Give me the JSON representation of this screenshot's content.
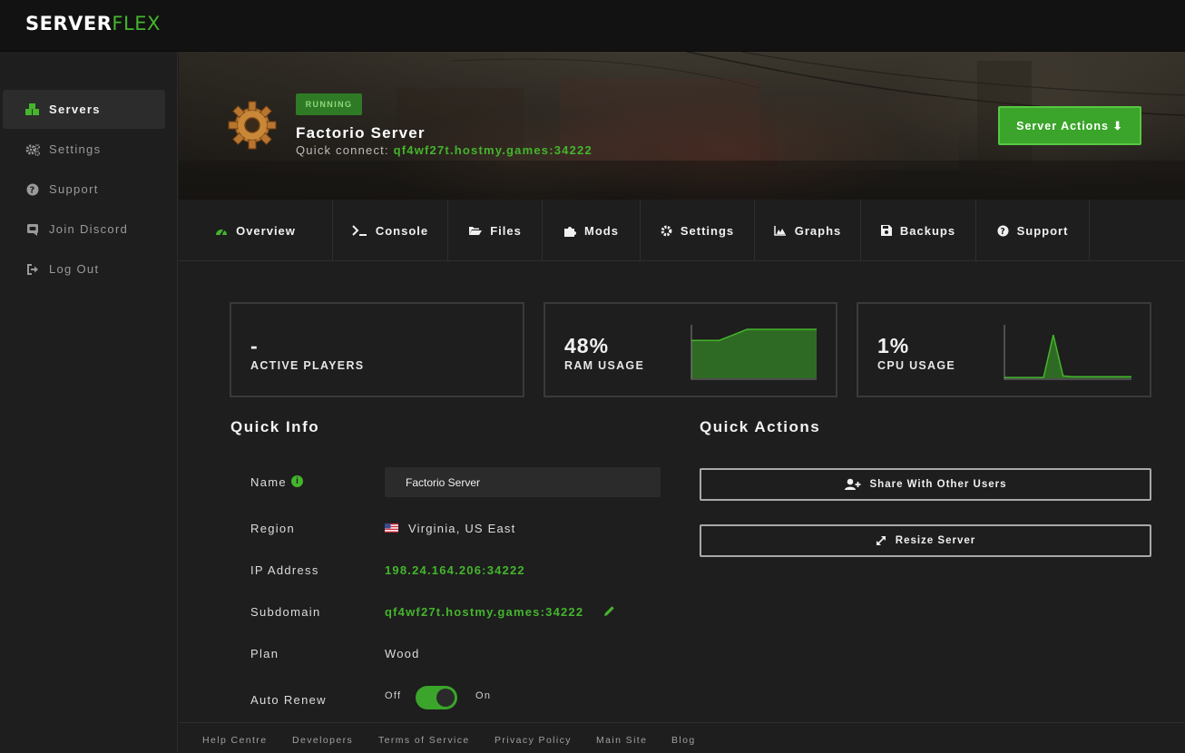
{
  "brand": {
    "part1": "SERVER",
    "part2": "FLEX"
  },
  "sidebar": {
    "items": [
      {
        "label": "Servers",
        "icon": "cubes-icon"
      },
      {
        "label": "Settings",
        "icon": "cogs-icon"
      },
      {
        "label": "Support",
        "icon": "question-circle-icon"
      },
      {
        "label": "Join Discord",
        "icon": "discord-icon"
      },
      {
        "label": "Log Out",
        "icon": "sign-out-icon"
      }
    ]
  },
  "hero": {
    "status": "RUNNING",
    "server_name": "Factorio Server",
    "quick_connect_label": "Quick connect:",
    "quick_connect_value": "qf4wf27t.hostmy.games:34222",
    "actions_button": "Server Actions ⬇"
  },
  "tabs": [
    {
      "label": "Overview",
      "icon": "tachometer-icon"
    },
    {
      "label": "Console",
      "icon": "terminal-icon"
    },
    {
      "label": "Files",
      "icon": "folder-open-icon"
    },
    {
      "label": "Mods",
      "icon": "puzzle-icon"
    },
    {
      "label": "Settings",
      "icon": "cog-icon"
    },
    {
      "label": "Graphs",
      "icon": "area-chart-icon"
    },
    {
      "label": "Backups",
      "icon": "save-icon"
    },
    {
      "label": "Support",
      "icon": "question-circle-icon"
    }
  ],
  "stats": {
    "players": {
      "value": "-",
      "label": "ACTIVE PLAYERS"
    },
    "ram": {
      "value": "48%",
      "label": "RAM USAGE",
      "history": [
        48,
        48,
        48,
        55,
        62,
        62,
        62,
        62,
        62,
        62
      ]
    },
    "cpu": {
      "value": "1%",
      "label": "CPU USAGE",
      "history": [
        1,
        1,
        1,
        1,
        1,
        55,
        3,
        2,
        2,
        2,
        2,
        2,
        2,
        2
      ]
    }
  },
  "quick_info": {
    "title": "Quick Info",
    "name_label": "Name",
    "name_value": "Factorio Server",
    "region_label": "Region",
    "region_value": "Virginia, US East",
    "ip_label": "IP Address",
    "ip_value": "198.24.164.206:34222",
    "subdomain_label": "Subdomain",
    "subdomain_value": "qf4wf27t.hostmy.games:34222",
    "plan_label": "Plan",
    "plan_value": "Wood",
    "auto_renew_label": "Auto Renew",
    "toggle_off": "Off",
    "toggle_on": "On",
    "auto_renew_enabled": true
  },
  "quick_actions": {
    "title": "Quick Actions",
    "share_button": "Share With Other Users",
    "resize_button": "Resize Server"
  },
  "footer": {
    "links": [
      "Help Centre",
      "Developers",
      "Terms of Service",
      "Privacy Policy",
      "Main Site",
      "Blog"
    ]
  },
  "colors": {
    "accent": "#44b52c",
    "background": "#1e1e1e",
    "topbar": "#121212"
  }
}
